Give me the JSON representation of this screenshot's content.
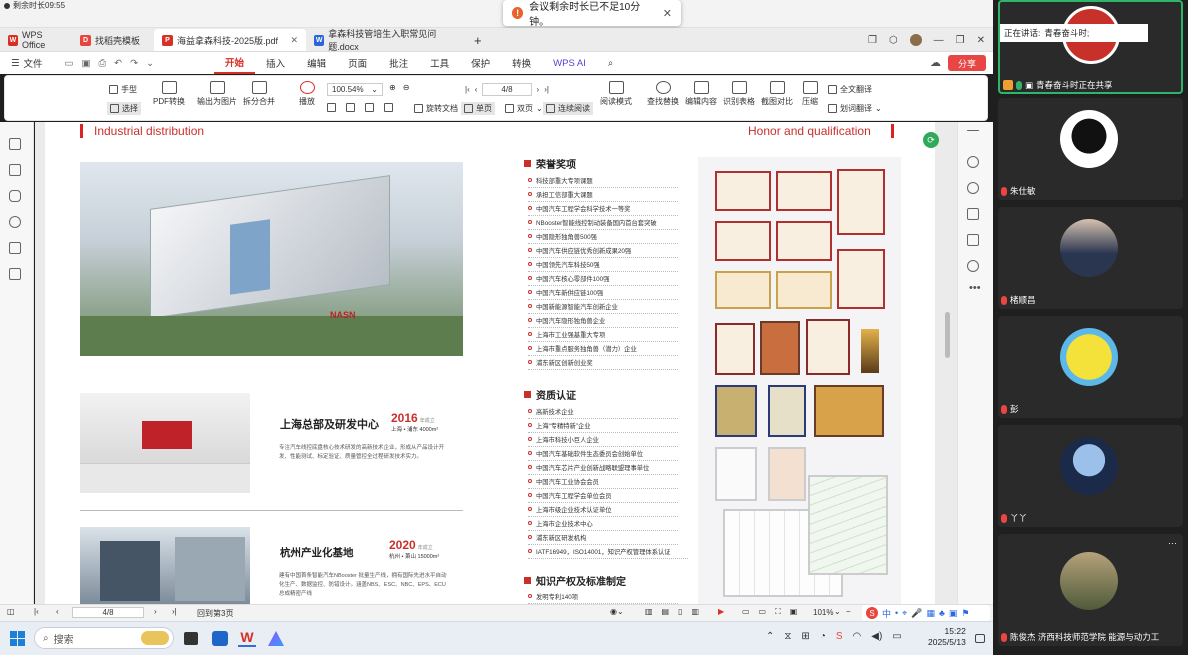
{
  "meeting": {
    "timer_text": "剩余时长09:55",
    "toast_text": "会议剩余时长已不足10分钟。",
    "toast_close": "✕"
  },
  "tabs": [
    {
      "label": "WPS Office",
      "color": "#d93025",
      "glyph": "W"
    },
    {
      "label": "找稻壳模板",
      "color": "#e8453c",
      "glyph": "D"
    },
    {
      "label": "海益拿森科技-2025版.pdf",
      "color": "#d93025",
      "glyph": "P"
    },
    {
      "label": "拿森科技管培生入职常见问题.docx",
      "color": "#2b65d9",
      "glyph": "W"
    }
  ],
  "tab_add": "+",
  "menu": {
    "file": "文件",
    "items": [
      "开始",
      "插入",
      "编辑",
      "页面",
      "批注",
      "工具",
      "保护",
      "转换",
      "WPS AI"
    ],
    "share": "分享"
  },
  "ribbon": {
    "hand": "手型",
    "select": "选择",
    "pdf_convert": "PDF转换",
    "export_image": "输出为图片",
    "split_merge": "拆分合并",
    "play": "播放",
    "zoom": "100.54%",
    "page": "4/8",
    "rotate": "旋转文档",
    "single": "单页",
    "double": "双页",
    "continuous": "连续阅读",
    "read_mode": "阅读模式",
    "find_replace": "查找替换",
    "edit_content": "编辑内容",
    "recognize_table": "识别表格",
    "compare": "截图对比",
    "compress": "压缩",
    "full_translate": "全文翻译",
    "word_translate": "划词翻译"
  },
  "doc": {
    "left_header": "Industrial distribution",
    "right_header": "Honor and qualification",
    "hq_title": "上海总部及研发中心",
    "hq_year": "2016",
    "hq_year_suffix": "年成立",
    "hq_loc": "上海 • 浦东 4000m²",
    "hq_desc": "专注汽车线控底盘核心技术研发的高新技术企业，形成从产品设计开发、性能测试、标定验证、质量管控全过程研发技术实力。",
    "hz_title": "杭州产业化基地",
    "hz_year": "2020",
    "hz_year_suffix": "年成立",
    "hz_loc": "杭州 • 萧山 15000m²",
    "hz_desc": "建有中国首条智能汽车NBooster 批量生产线，拥有国际先进水平自动化生产、数据监控、防错设计。涵盖NBS、ESC、NBC、EPS、ECU 总成精密产线",
    "building_sign": "NASN",
    "honors_title": "荣誉奖项",
    "honors": [
      "科技部重大专项课题",
      "承担工信部重大课题",
      "中国汽车工程学会科学技术一等奖",
      "NBooster智能线控制动装备国内首台套突破",
      "中国隐形独角兽500强",
      "中国汽车供应链优秀创新成果20强",
      "中国领先汽车科技50强",
      "中国汽车核心零部件100强",
      "中国汽车新供应链100强",
      "中国新能源智能汽车创新企业",
      "中国汽车隐形独角兽企业",
      "上海市工业强基重大专项",
      "上海市重点服务独角兽（潜力）企业",
      "浦东新区创新创业奖"
    ],
    "qual_title": "资质认证",
    "quals": [
      "高新技术企业",
      "上海“专精特新”企业",
      "上海市科技小巨人企业",
      "中国汽车基础软件生态委员会创始单位",
      "中国汽车芯片产业创新战略联盟理事单位",
      "中国汽车工业协会会员",
      "中国汽车工程学会单位会员",
      "上海市级企业技术认证单位",
      "上海市企业技术中心",
      "浦东新区研发机构",
      "IATF16949，ISO14001，知识产权管理体系认证"
    ],
    "ip_title": "知识产权及标准制定",
    "ip_items": [
      "发明专利140项"
    ]
  },
  "status": {
    "page": "4/8",
    "back": "回到第3页",
    "zoom": "101%"
  },
  "taskbar": {
    "search": "搜索",
    "time": "15:22",
    "date": "2025/5/13",
    "ime": "中"
  },
  "participants": {
    "speaking_label": "正在讲话:",
    "speaking_name": "青春奋斗时;",
    "sharing": "青春奋斗时正在共享",
    "tiles": [
      {
        "name": "朱仕敏",
        "bg": "#ffffff"
      },
      {
        "name": "楮顺昌",
        "bg": "#3a4a6a"
      },
      {
        "name": "彭",
        "bg": "#5bb8e8"
      },
      {
        "name": "丫丫",
        "bg": "#4a5d8a"
      },
      {
        "name": "陈俊杰 济西科技师范学院 能源与动力工",
        "bg": "#6a7a50"
      }
    ],
    "more": "···"
  }
}
